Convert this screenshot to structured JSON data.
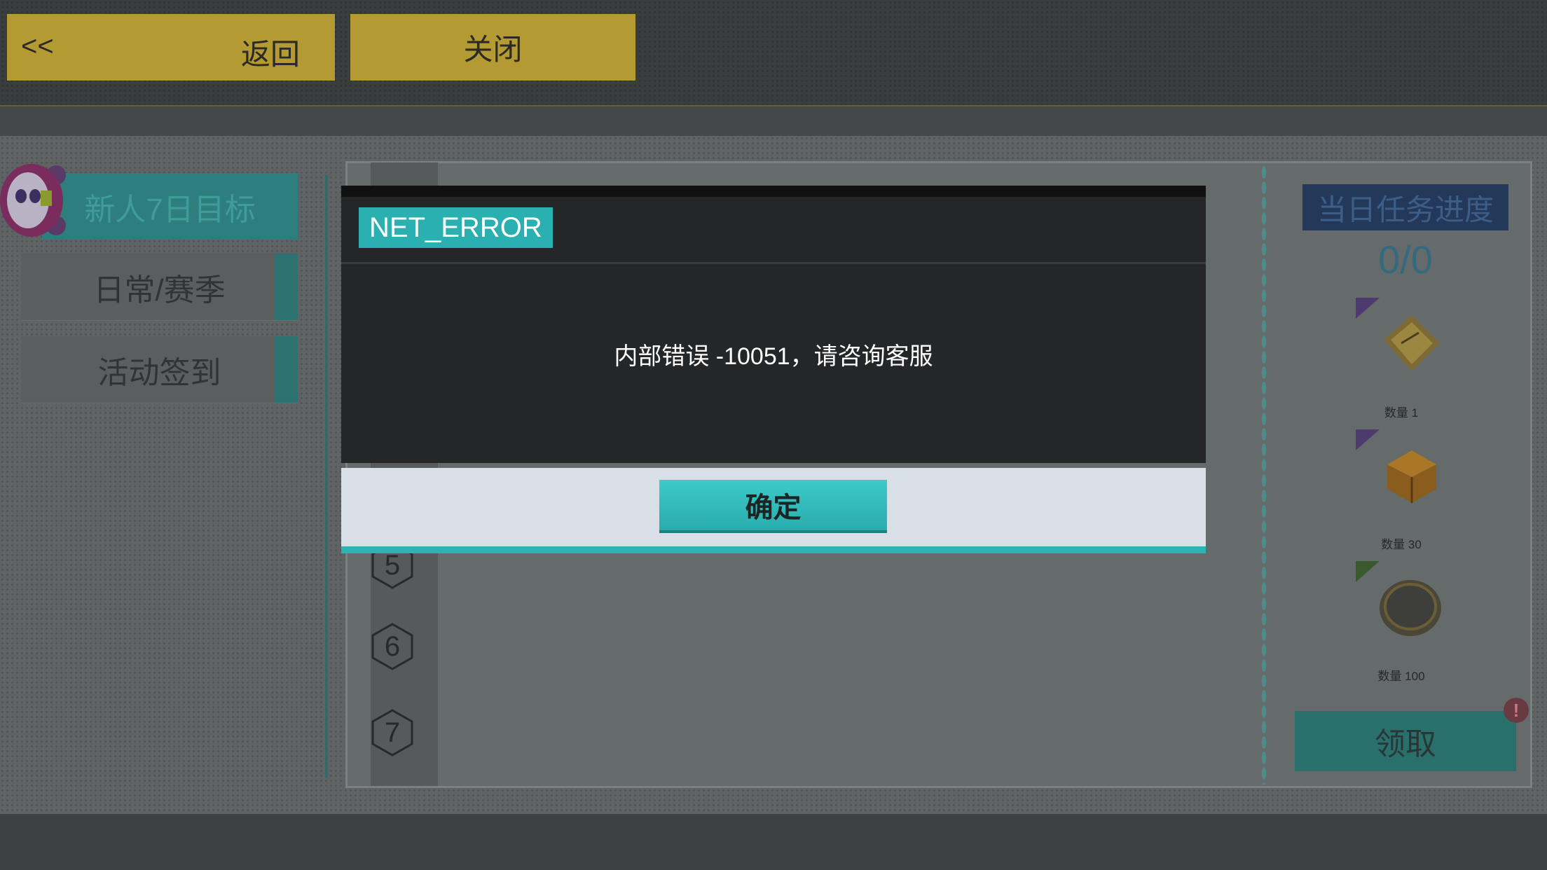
{
  "topbar": {
    "back_arrows": "<<",
    "back_label": "返回",
    "close_label": "关闭"
  },
  "menu": {
    "items": [
      {
        "label": "新人7日目标"
      },
      {
        "label": "日常/赛季"
      },
      {
        "label": "活动签到"
      }
    ]
  },
  "days": [
    "5",
    "6",
    "7"
  ],
  "progress": {
    "title": "当日任务进度",
    "value": "0/0"
  },
  "rewards": [
    {
      "qty": "数量 1",
      "icon": "ticket-icon"
    },
    {
      "qty": "数量 30",
      "icon": "gem-box-icon"
    },
    {
      "qty": "数量 100",
      "icon": "coin-icon"
    }
  ],
  "claim_label": "领取",
  "alert": "!",
  "dialog": {
    "title": "NET_ERROR",
    "message": "内部错误 -10051，请咨询客服",
    "ok_label": "确定"
  },
  "colors": {
    "accent_teal": "#2ab0b0",
    "gold": "#b39a32"
  }
}
